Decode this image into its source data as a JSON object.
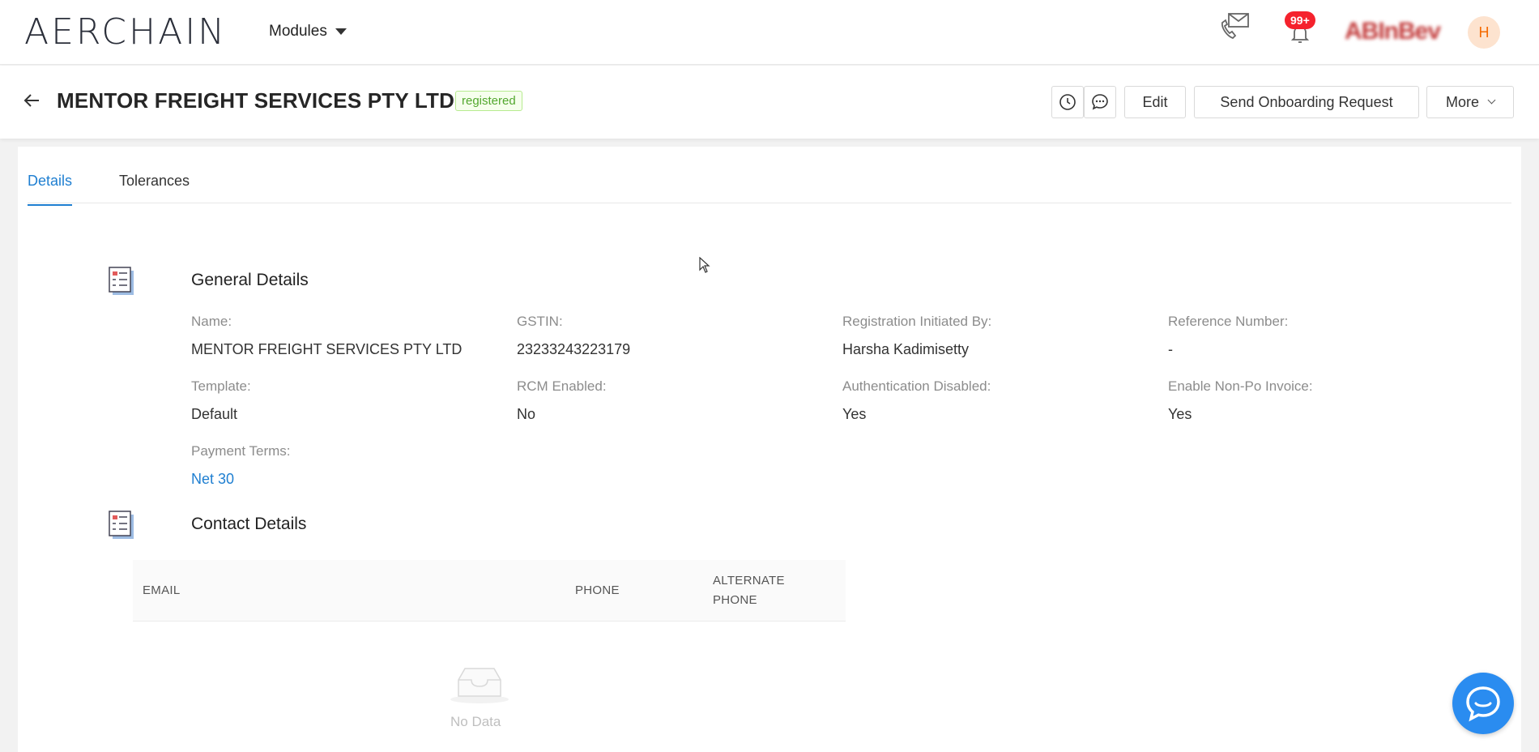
{
  "app": {
    "logo": "AERCHAIN",
    "modules_label": "Modules",
    "notifications_count": "99+",
    "brand": "ABInBev",
    "avatar_initial": "H"
  },
  "header": {
    "title": "MENTOR FREIGHT SERVICES PTY LTD",
    "status": "registered",
    "edit_label": "Edit",
    "onboarding_label": "Send Onboarding Request",
    "more_label": "More"
  },
  "tabs": [
    {
      "label": "Details",
      "active": true
    },
    {
      "label": "Tolerances",
      "active": false
    }
  ],
  "general": {
    "title": "General Details",
    "fields": [
      {
        "label": "Name:",
        "value": "MENTOR FREIGHT SERVICES PTY LTD"
      },
      {
        "label": "GSTIN:",
        "value": "23233243223179"
      },
      {
        "label": "Registration Initiated By:",
        "value": "Harsha Kadimisetty"
      },
      {
        "label": "Reference Number:",
        "value": "-"
      },
      {
        "label": "Template:",
        "value": "Default"
      },
      {
        "label": "RCM Enabled:",
        "value": "No"
      },
      {
        "label": "Authentication Disabled:",
        "value": "Yes"
      },
      {
        "label": "Enable Non-Po Invoice:",
        "value": "Yes"
      },
      {
        "label": "Payment Terms:",
        "value": "Net 30"
      }
    ]
  },
  "contact": {
    "title": "Contact Details",
    "columns": [
      "EMAIL",
      "PHONE",
      "ALTERNATE PHONE"
    ],
    "empty_text": "No Data"
  },
  "colors": {
    "accent": "#1f7fd1",
    "badge": "#f5222d",
    "registered_green": "#52a72e",
    "fab": "#2a8cf0"
  }
}
